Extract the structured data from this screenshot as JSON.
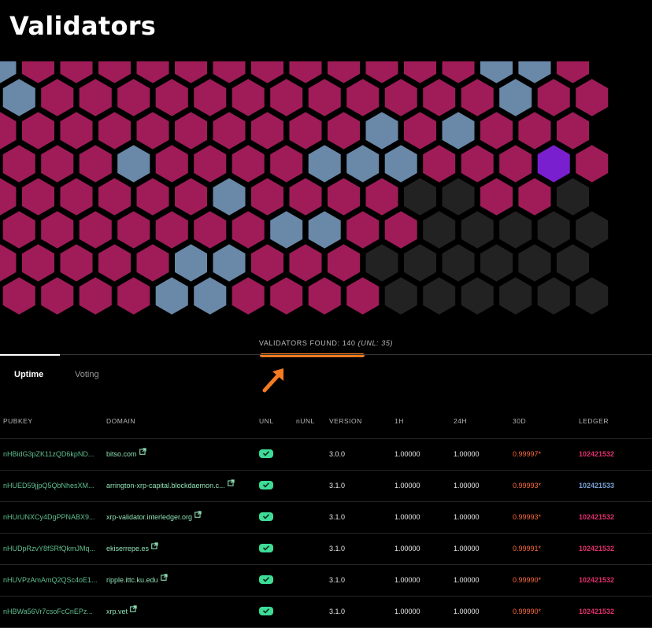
{
  "page": {
    "title": "Validators"
  },
  "map": {
    "colors": {
      "unl": "#9f1c58",
      "other": "#6a88a8",
      "offline": "#222222",
      "purple": "#7a1fd0",
      "border": "#000000"
    },
    "found_label": "VALIDATORS FOUND: 140",
    "unl_label": "(UNL: 35)"
  },
  "tabs": [
    {
      "label": "Uptime",
      "active": true
    },
    {
      "label": "Voting",
      "active": false
    }
  ],
  "annotation": {
    "color": "#f47a20",
    "icon": "arrow-up-right-icon"
  },
  "table": {
    "headers": {
      "pubkey": "PUBKEY",
      "domain": "DOMAIN",
      "unl": "UNL",
      "nunl": "nUNL",
      "version": "VERSION",
      "h1": "1H",
      "h24": "24H",
      "d30": "30D",
      "ledger": "LEDGER"
    },
    "rows": [
      {
        "pubkey": "nHBidG3pZK11zQD6kpND...",
        "domain": "bitso.com",
        "unl": true,
        "version": "3.0.0",
        "h1": "1.00000",
        "h24": "1.00000",
        "d30": "0.99997*",
        "ledger": "102421532"
      },
      {
        "pubkey": "nHUED59jjpQ5QbNhesXM...",
        "domain": "arrington-xrp-capital.blockdaemon.c...",
        "unl": true,
        "version": "3.1.0",
        "h1": "1.00000",
        "h24": "1.00000",
        "d30": "0.99993*",
        "ledger": "102421533"
      },
      {
        "pubkey": "nHUrUNXCy4DgPPNABX9...",
        "domain": "xrp-validator.interledger.org",
        "unl": true,
        "version": "3.1.0",
        "h1": "1.00000",
        "h24": "1.00000",
        "d30": "0.99993*",
        "ledger": "102421532"
      },
      {
        "pubkey": "nHUDpRzvY8fSRfQkmJMq...",
        "domain": "ekiserrepe.es",
        "unl": true,
        "version": "3.1.0",
        "h1": "1.00000",
        "h24": "1.00000",
        "d30": "0.99991*",
        "ledger": "102421532"
      },
      {
        "pubkey": "nHUVPzAmAmQ2QSc4oE1...",
        "domain": "ripple.ittc.ku.edu",
        "unl": true,
        "version": "3.1.0",
        "h1": "1.00000",
        "h24": "1.00000",
        "d30": "0.99990*",
        "ledger": "102421532"
      },
      {
        "pubkey": "nHBWa56Vr7csoFcCnEPz...",
        "domain": "xrp.vet",
        "unl": true,
        "version": "3.1.0",
        "h1": "1.00000",
        "h24": "1.00000",
        "d30": "0.99990*",
        "ledger": "102421532"
      }
    ]
  }
}
